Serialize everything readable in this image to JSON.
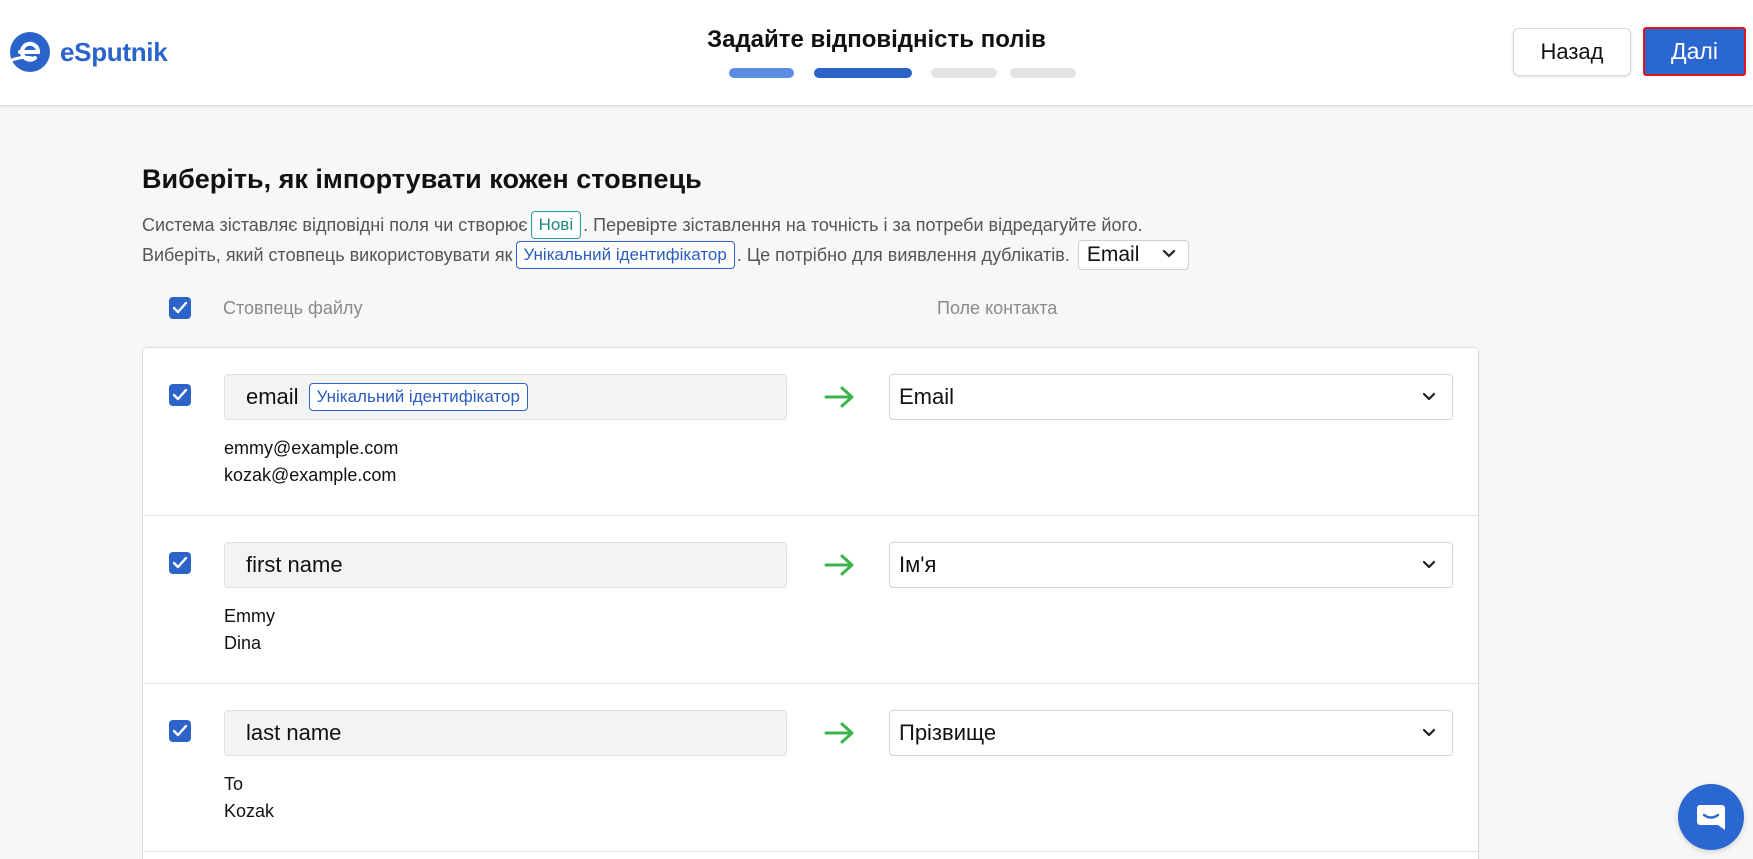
{
  "brand": {
    "name": "eSputnik",
    "color": "#2a63c9"
  },
  "header": {
    "title": "Задайте відповідність полів",
    "back_label": "Назад",
    "next_label": "Далі",
    "steps": [
      {
        "state": "done",
        "color": "#5b8ee3"
      },
      {
        "state": "current",
        "color": "#2b63c9"
      },
      {
        "state": "pending",
        "color": "#e3e3e3"
      },
      {
        "state": "pending",
        "color": "#e3e3e3"
      }
    ]
  },
  "main": {
    "heading": "Виберіть, як імпортувати кожен стовпець",
    "desc1_before": "Система зіставляє відповідні поля чи створює",
    "desc1_chip": "Нові",
    "desc1_after": ". Перевірте зіставлення на точність і за потреби відредагуйте його.",
    "desc2_before": "Виберіть, який стовпець використовувати як",
    "desc2_chip": "Унікальний ідентифікатор",
    "desc2_after": ". Це потрібно для виявлення дублікатів.",
    "dedupe_field": "Email",
    "col_file": "Стовпець файлу",
    "col_contact": "Поле контакта"
  },
  "rows": [
    {
      "checked": true,
      "column": "email",
      "badge": "Унікальний ідентифікатор",
      "target": "Email",
      "samples": [
        "emmy@example.com",
        "kozak@example.com"
      ]
    },
    {
      "checked": true,
      "column": "first name",
      "badge": "",
      "target": "Ім'я",
      "samples": [
        "Emmy",
        "Dina"
      ]
    },
    {
      "checked": true,
      "column": "last name",
      "badge": "",
      "target": "Прізвище",
      "samples": [
        "To",
        "Kozak"
      ]
    }
  ],
  "icons": {
    "logo": "esputnik-logo-icon",
    "arrow": "arrow-right-icon",
    "chevron": "chevron-down-icon",
    "check": "check-icon",
    "chat": "chat-icon"
  },
  "colors": {
    "accent": "#2b67d0",
    "arrow": "#3cb34a",
    "highlight_border": "#e3141c"
  }
}
